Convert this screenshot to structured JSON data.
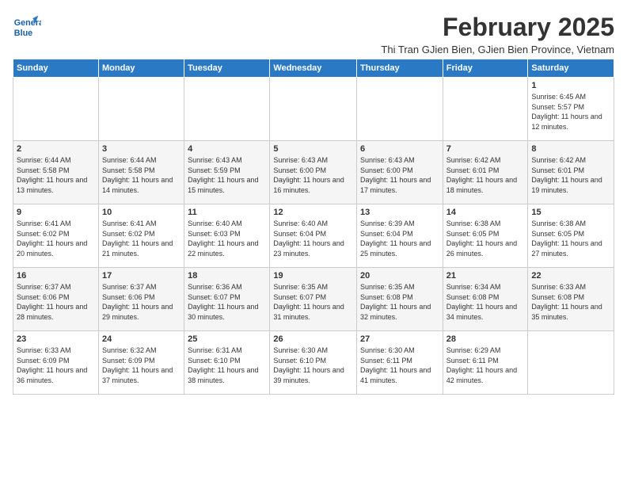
{
  "logo": {
    "line1": "General",
    "line2": "Blue"
  },
  "title": "February 2025",
  "subtitle": "Thi Tran GJien Bien, GJien Bien Province, Vietnam",
  "days_of_week": [
    "Sunday",
    "Monday",
    "Tuesday",
    "Wednesday",
    "Thursday",
    "Friday",
    "Saturday"
  ],
  "weeks": [
    [
      {
        "day": "",
        "info": ""
      },
      {
        "day": "",
        "info": ""
      },
      {
        "day": "",
        "info": ""
      },
      {
        "day": "",
        "info": ""
      },
      {
        "day": "",
        "info": ""
      },
      {
        "day": "",
        "info": ""
      },
      {
        "day": "1",
        "info": "Sunrise: 6:45 AM\nSunset: 5:57 PM\nDaylight: 11 hours and 12 minutes."
      }
    ],
    [
      {
        "day": "2",
        "info": "Sunrise: 6:44 AM\nSunset: 5:58 PM\nDaylight: 11 hours and 13 minutes."
      },
      {
        "day": "3",
        "info": "Sunrise: 6:44 AM\nSunset: 5:58 PM\nDaylight: 11 hours and 14 minutes."
      },
      {
        "day": "4",
        "info": "Sunrise: 6:43 AM\nSunset: 5:59 PM\nDaylight: 11 hours and 15 minutes."
      },
      {
        "day": "5",
        "info": "Sunrise: 6:43 AM\nSunset: 6:00 PM\nDaylight: 11 hours and 16 minutes."
      },
      {
        "day": "6",
        "info": "Sunrise: 6:43 AM\nSunset: 6:00 PM\nDaylight: 11 hours and 17 minutes."
      },
      {
        "day": "7",
        "info": "Sunrise: 6:42 AM\nSunset: 6:01 PM\nDaylight: 11 hours and 18 minutes."
      },
      {
        "day": "8",
        "info": "Sunrise: 6:42 AM\nSunset: 6:01 PM\nDaylight: 11 hours and 19 minutes."
      }
    ],
    [
      {
        "day": "9",
        "info": "Sunrise: 6:41 AM\nSunset: 6:02 PM\nDaylight: 11 hours and 20 minutes."
      },
      {
        "day": "10",
        "info": "Sunrise: 6:41 AM\nSunset: 6:02 PM\nDaylight: 11 hours and 21 minutes."
      },
      {
        "day": "11",
        "info": "Sunrise: 6:40 AM\nSunset: 6:03 PM\nDaylight: 11 hours and 22 minutes."
      },
      {
        "day": "12",
        "info": "Sunrise: 6:40 AM\nSunset: 6:04 PM\nDaylight: 11 hours and 23 minutes."
      },
      {
        "day": "13",
        "info": "Sunrise: 6:39 AM\nSunset: 6:04 PM\nDaylight: 11 hours and 25 minutes."
      },
      {
        "day": "14",
        "info": "Sunrise: 6:38 AM\nSunset: 6:05 PM\nDaylight: 11 hours and 26 minutes."
      },
      {
        "day": "15",
        "info": "Sunrise: 6:38 AM\nSunset: 6:05 PM\nDaylight: 11 hours and 27 minutes."
      }
    ],
    [
      {
        "day": "16",
        "info": "Sunrise: 6:37 AM\nSunset: 6:06 PM\nDaylight: 11 hours and 28 minutes."
      },
      {
        "day": "17",
        "info": "Sunrise: 6:37 AM\nSunset: 6:06 PM\nDaylight: 11 hours and 29 minutes."
      },
      {
        "day": "18",
        "info": "Sunrise: 6:36 AM\nSunset: 6:07 PM\nDaylight: 11 hours and 30 minutes."
      },
      {
        "day": "19",
        "info": "Sunrise: 6:35 AM\nSunset: 6:07 PM\nDaylight: 11 hours and 31 minutes."
      },
      {
        "day": "20",
        "info": "Sunrise: 6:35 AM\nSunset: 6:08 PM\nDaylight: 11 hours and 32 minutes."
      },
      {
        "day": "21",
        "info": "Sunrise: 6:34 AM\nSunset: 6:08 PM\nDaylight: 11 hours and 34 minutes."
      },
      {
        "day": "22",
        "info": "Sunrise: 6:33 AM\nSunset: 6:08 PM\nDaylight: 11 hours and 35 minutes."
      }
    ],
    [
      {
        "day": "23",
        "info": "Sunrise: 6:33 AM\nSunset: 6:09 PM\nDaylight: 11 hours and 36 minutes."
      },
      {
        "day": "24",
        "info": "Sunrise: 6:32 AM\nSunset: 6:09 PM\nDaylight: 11 hours and 37 minutes."
      },
      {
        "day": "25",
        "info": "Sunrise: 6:31 AM\nSunset: 6:10 PM\nDaylight: 11 hours and 38 minutes."
      },
      {
        "day": "26",
        "info": "Sunrise: 6:30 AM\nSunset: 6:10 PM\nDaylight: 11 hours and 39 minutes."
      },
      {
        "day": "27",
        "info": "Sunrise: 6:30 AM\nSunset: 6:11 PM\nDaylight: 11 hours and 41 minutes."
      },
      {
        "day": "28",
        "info": "Sunrise: 6:29 AM\nSunset: 6:11 PM\nDaylight: 11 hours and 42 minutes."
      },
      {
        "day": "",
        "info": ""
      }
    ]
  ]
}
